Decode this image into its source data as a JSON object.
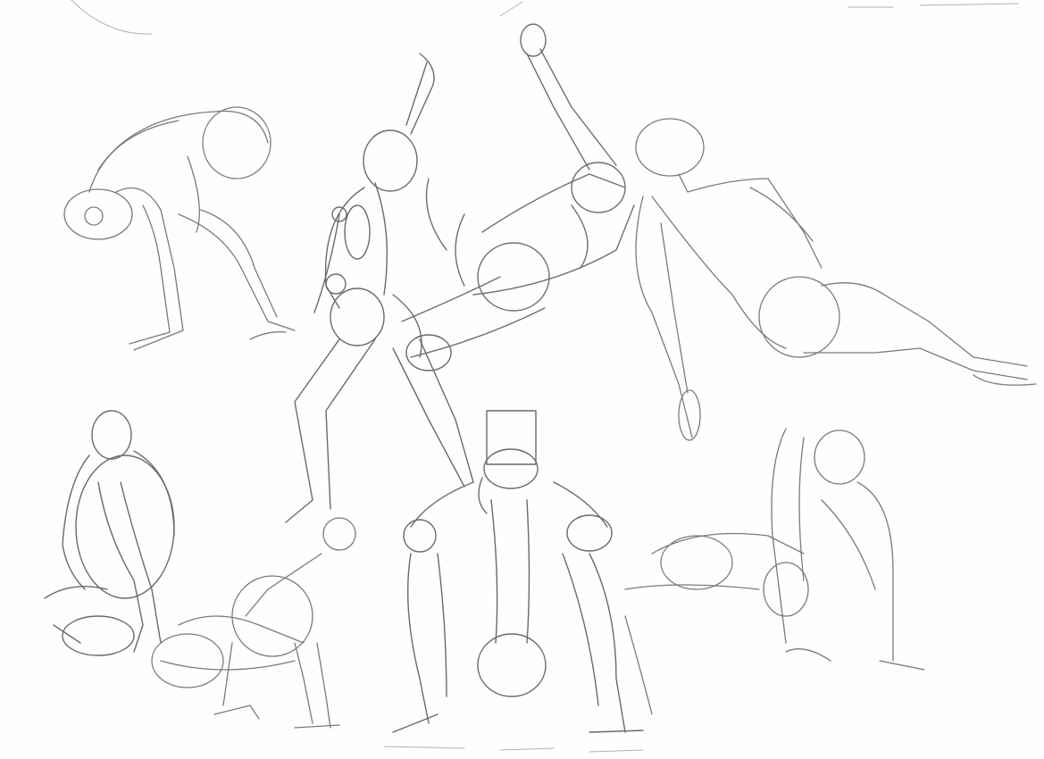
{
  "sheet": {
    "paper_color": "#fefefe",
    "pencil_color": "#6f6f6f",
    "pencil_light": "#a8a8a8",
    "pencil_dark": "#4a4a4a"
  },
  "figures": [
    {
      "name": "crouching-figure"
    },
    {
      "name": "reaching-standing-figure"
    },
    {
      "name": "leaning-arm-raised-figure"
    },
    {
      "name": "reclining-figure"
    },
    {
      "name": "seated-hugging-knees-figure"
    },
    {
      "name": "kneeling-forward-figure"
    },
    {
      "name": "squatting-figure"
    },
    {
      "name": "seated-leaning-back-figure"
    }
  ]
}
